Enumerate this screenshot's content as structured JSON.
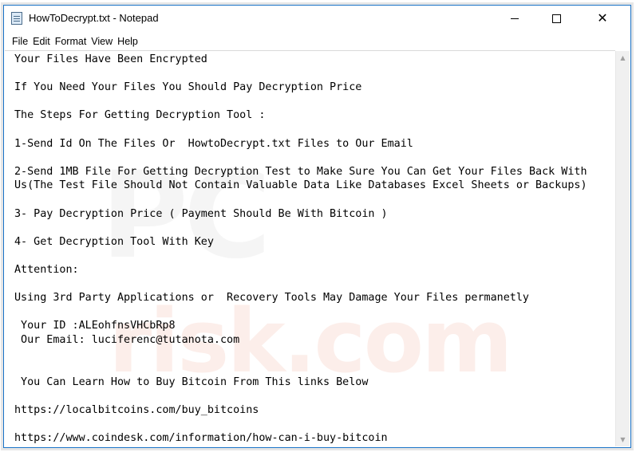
{
  "window": {
    "title": "HowToDecrypt.txt - Notepad",
    "icon": "notepad-icon",
    "controls": {
      "minimize": "minimize-icon",
      "maximize": "maximize-icon",
      "close": "close-icon",
      "close_glyph": "✕"
    }
  },
  "menu": {
    "items": [
      "File",
      "Edit",
      "Format",
      "View",
      "Help"
    ]
  },
  "document": {
    "lines": [
      "Your Files Have Been Encrypted",
      "",
      "If You Need Your Files You Should Pay Decryption Price",
      "",
      "The Steps For Getting Decryption Tool :",
      "",
      "1-Send Id On The Files Or  HowtoDecrypt.txt Files to Our Email",
      "",
      "2-Send 1MB File For Getting Decryption Test to Make Sure You Can Get Your Files Back With",
      "Us(The Test File Should Not Contain Valuable Data Like Databases Excel Sheets or Backups)",
      "",
      "3- Pay Decryption Price ( Payment Should Be With Bitcoin )",
      "",
      "4- Get Decryption Tool With Key",
      "",
      "Attention:",
      "",
      "Using 3rd Party Applications or  Recovery Tools May Damage Your Files permanetly",
      "",
      " Your ID :ALEohfnsVHCbRp8",
      " Our Email: luciferenc@tutanota.com",
      "",
      "",
      " You Can Learn How to Buy Bitcoin From This links Below",
      "",
      "https://localbitcoins.com/buy_bitcoins",
      "",
      "https://www.coindesk.com/information/how-can-i-buy-bitcoin"
    ]
  },
  "scrollbar": {
    "up_glyph": "▲",
    "down_glyph": "▼"
  }
}
